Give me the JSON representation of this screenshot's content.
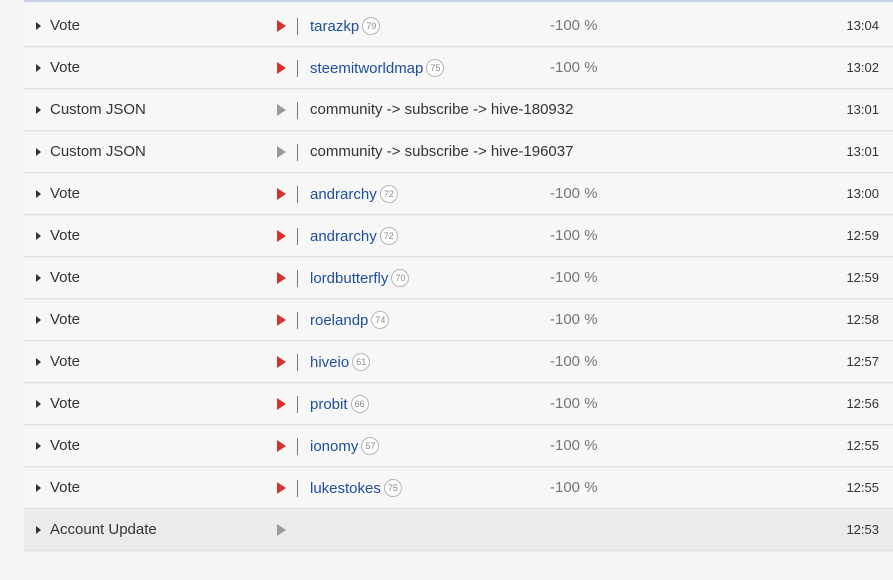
{
  "rows": [
    {
      "op": "Vote",
      "user": "tarazkp",
      "rep": "79",
      "pct": "-100 %",
      "time": "13:04"
    },
    {
      "op": "Vote",
      "user": "steemitworldmap",
      "rep": "75",
      "pct": "-100 %",
      "time": "13:02"
    },
    {
      "op": "Custom JSON",
      "detail": "community -> subscribe -> hive-180932",
      "time": "13:01"
    },
    {
      "op": "Custom JSON",
      "detail": "community -> subscribe -> hive-196037",
      "time": "13:01"
    },
    {
      "op": "Vote",
      "user": "andrarchy",
      "rep": "72",
      "pct": "-100 %",
      "time": "13:00"
    },
    {
      "op": "Vote",
      "user": "andrarchy",
      "rep": "72",
      "pct": "-100 %",
      "time": "12:59"
    },
    {
      "op": "Vote",
      "user": "lordbutterfly",
      "rep": "70",
      "pct": "-100 %",
      "time": "12:59"
    },
    {
      "op": "Vote",
      "user": "roelandp",
      "rep": "74",
      "pct": "-100 %",
      "time": "12:58"
    },
    {
      "op": "Vote",
      "user": "hiveio",
      "rep": "61",
      "pct": "-100 %",
      "time": "12:57"
    },
    {
      "op": "Vote",
      "user": "probit",
      "rep": "66",
      "pct": "-100 %",
      "time": "12:56"
    },
    {
      "op": "Vote",
      "user": "ionomy",
      "rep": "57",
      "pct": "-100 %",
      "time": "12:55"
    },
    {
      "op": "Vote",
      "user": "lukestokes",
      "rep": "75",
      "pct": "-100 %",
      "time": "12:55"
    },
    {
      "op": "Account Update",
      "time": "12:53"
    }
  ],
  "icons": {
    "expand": "caret-right-icon",
    "vote": "vote-flag-icon",
    "other": "op-flag-icon"
  },
  "colors": {
    "vote_flag": "#d8322c",
    "other_flag": "#9a9a9a",
    "user_link": "#1d4e9e"
  }
}
